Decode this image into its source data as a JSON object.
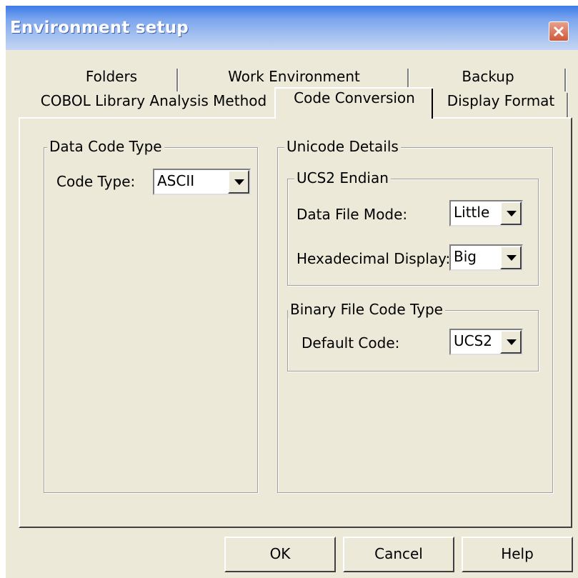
{
  "window": {
    "title": "Environment setup"
  },
  "tabs": {
    "row1": [
      "Folders",
      "Work Environment",
      "Backup"
    ],
    "row2": [
      "COBOL Library Analysis Method",
      "Code Conversion",
      "Display Format"
    ]
  },
  "data_code_type": {
    "title": "Data Code Type",
    "code_type_label": "Code Type:",
    "code_type_value": "ASCII"
  },
  "unicode_details": {
    "title": "Unicode Details",
    "ucs2_endian": {
      "title": "UCS2 Endian",
      "data_file_mode_label": "Data File Mode:",
      "data_file_mode_value": "Little",
      "hex_display_label": "Hexadecimal Display:",
      "hex_display_value": "Big"
    },
    "binary_file": {
      "title": "Binary File Code Type",
      "default_code_label": "Default Code:",
      "default_code_value": "UCS2"
    }
  },
  "buttons": {
    "ok": "OK",
    "cancel": "Cancel",
    "help": "Help"
  },
  "colors": {
    "dialog_bg": "#ece9d8",
    "title_bar": "#7aa5ee",
    "close_button": "#d0583a"
  },
  "icons": {
    "close": "close-icon",
    "dropdown": "chevron-down-icon"
  }
}
